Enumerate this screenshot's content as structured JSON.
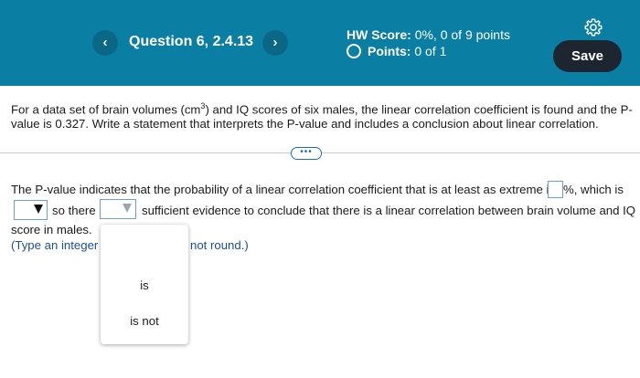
{
  "header": {
    "prev_icon": "chevron-left-icon",
    "prev_glyph": "‹",
    "next_icon": "chevron-right-icon",
    "next_glyph": "›",
    "question_title": "Question 6, 2.4.13",
    "hw_score_label": "HW Score:",
    "hw_score_value": "0%, 0 of 9 points",
    "points_label": "Points:",
    "points_value": "0 of 1",
    "settings_icon": "gear-icon",
    "save_label": "Save",
    "colors": {
      "bar": "#0b7ea3",
      "save_button": "#1c2530"
    }
  },
  "question": {
    "text_before_sup": "For a data set of brain volumes (cm",
    "sup": "3",
    "text_after_sup": ") and IQ scores of six males, the linear correlation coefficient is found and the P-value is 0.327. Write a statement that interprets the P-value and includes a conclusion about linear correlation."
  },
  "more_label": "•••",
  "answer": {
    "line1_start": "The P-value indicates that the probability of a linear correlation coefficient that is at least as extreme is",
    "line1_end": "%, which is",
    "line2_so_there": "so there",
    "line2_rest": "sufficient evidence to conclude that there is a linear correlation between brain volume and IQ",
    "line3": "score in males.",
    "note_start": "(Type an integer",
    "note_end": "not round.)"
  },
  "dropdown": {
    "options": [
      "is",
      "is not"
    ]
  }
}
